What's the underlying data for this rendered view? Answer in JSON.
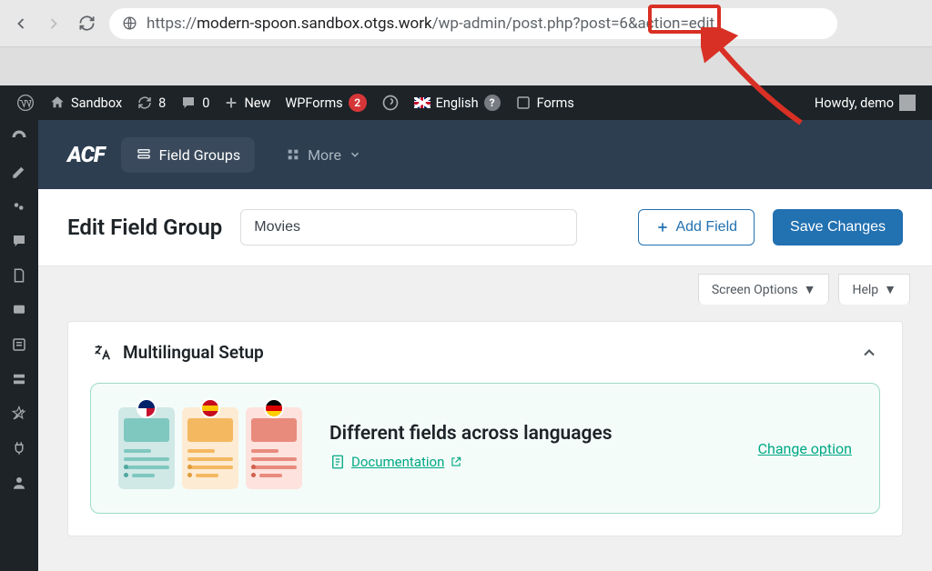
{
  "browser": {
    "url_host": "modern-spoon.sandbox.otgs.work",
    "url_prefix": "https://",
    "url_path": "/wp-admin/post.php?post=6&action=edit",
    "highlight_param": "post=6"
  },
  "wpbar": {
    "site": "Sandbox",
    "updates": "8",
    "comments": "0",
    "new": "New",
    "wpforms": "WPForms",
    "wpforms_badge": "2",
    "language": "English",
    "forms": "Forms",
    "greeting": "Howdy, demo"
  },
  "acf": {
    "logo": "ACF",
    "tab_groups": "Field Groups",
    "tab_more": "More"
  },
  "edit": {
    "heading": "Edit Field Group",
    "title_value": "Movies",
    "add_field": "Add Field",
    "save": "Save Changes"
  },
  "opts": {
    "screen_options": "Screen Options",
    "help": "Help"
  },
  "panel": {
    "title": "Multilingual Setup",
    "info_title": "Different fields across languages",
    "documentation": "Documentation",
    "change": "Change option"
  }
}
